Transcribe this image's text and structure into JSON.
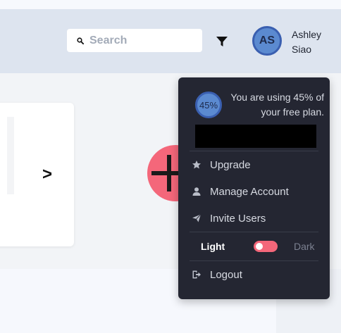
{
  "header": {
    "search": {
      "placeholder": "Search",
      "value": ""
    },
    "filter_icon": "filter-icon",
    "user": {
      "initials": "AS",
      "name": "Ashley Siao"
    }
  },
  "main": {
    "card_arrow": ">",
    "add_icon": "plus-icon"
  },
  "dropdown": {
    "usage": {
      "percent_label": "45%",
      "percent_value": 45,
      "text": "You are using 45% of your free plan."
    },
    "items": [
      {
        "label": "Upgrade",
        "icon": "star-icon"
      },
      {
        "label": "Manage Account",
        "icon": "user-icon"
      },
      {
        "label": "Invite Users",
        "icon": "paper-plane-icon"
      }
    ],
    "theme": {
      "light_label": "Light",
      "dark_label": "Dark",
      "selected": "Light"
    },
    "logout": {
      "label": "Logout",
      "icon": "logout-icon"
    }
  },
  "colors": {
    "accent": "#f4677a",
    "avatar": "#5b8ad0",
    "dropdown_bg": "#242632",
    "header_bg": "#dde4ef"
  }
}
